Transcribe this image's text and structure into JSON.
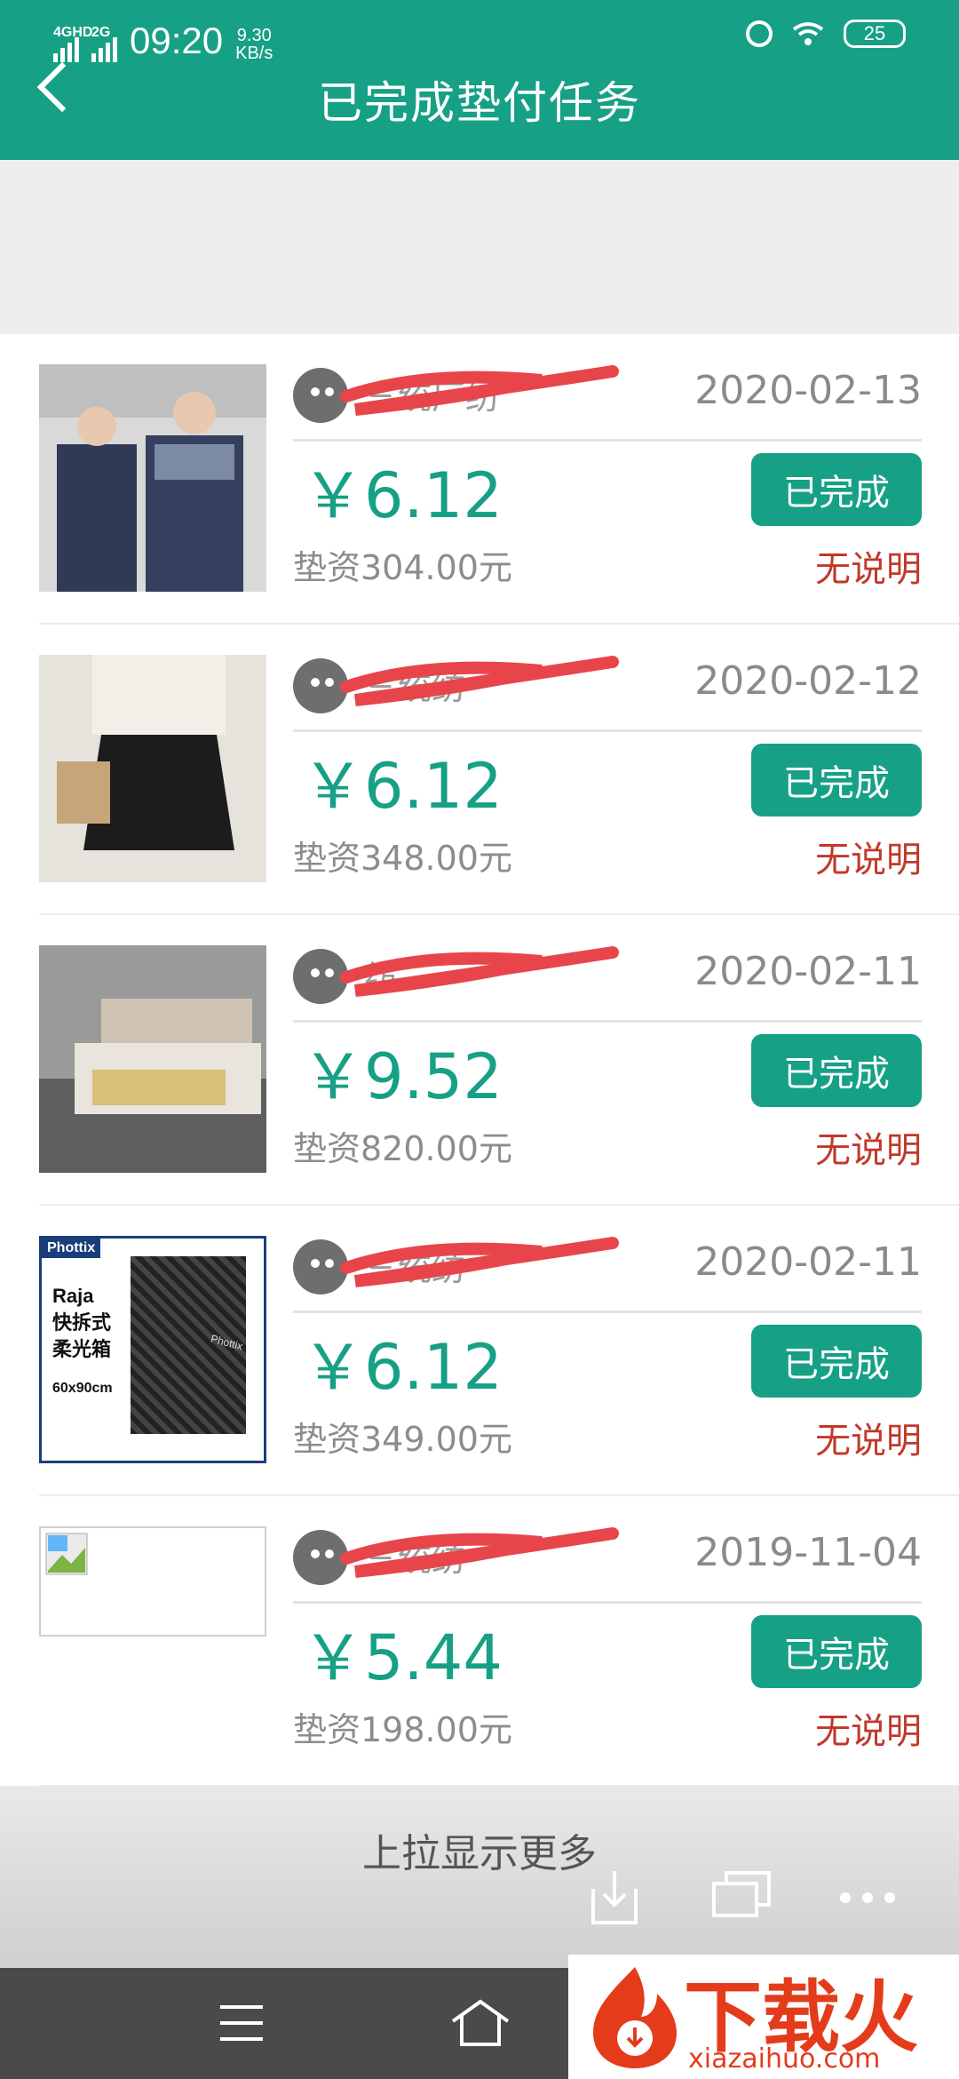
{
  "status_bar": {
    "network1": "4GHD",
    "network2": "2G",
    "time": "09:20",
    "speed_value": "9.30",
    "speed_unit": "KB/s",
    "battery": "25"
  },
  "header": {
    "title": "已完成垫付任务",
    "back_icon": "chevron-left-icon"
  },
  "tasks": [
    {
      "shop": "三统厂纺",
      "date": "2020-02-13",
      "amount": "￥6.12",
      "status": "已完成",
      "advance": "垫资304.00元",
      "note": "无说明",
      "thumb": "workwear"
    },
    {
      "shop": "三统纺",
      "date": "2020-02-12",
      "amount": "￥6.12",
      "status": "已完成",
      "advance": "垫资348.00元",
      "note": "无说明",
      "thumb": "skirt"
    },
    {
      "shop": "纺",
      "date": "2020-02-11",
      "amount": "￥9.52",
      "status": "已完成",
      "advance": "垫资820.00元",
      "note": "无说明",
      "thumb": "bed"
    },
    {
      "shop": "三统纺",
      "date": "2020-02-11",
      "amount": "￥6.12",
      "status": "已完成",
      "advance": "垫资349.00元",
      "note": "无说明",
      "thumb": "softbox",
      "thumb_text": {
        "brand": "Phottix",
        "line1": "Raja",
        "line2": "快拆式",
        "line3": "柔光箱",
        "size": "60x90cm"
      }
    },
    {
      "shop": "三统纺",
      "date": "2019-11-04",
      "amount": "￥5.44",
      "status": "已完成",
      "advance": "垫资198.00元",
      "note": "无说明",
      "thumb": "broken"
    }
  ],
  "footer": {
    "load_more": "上拉显示更多"
  },
  "watermark": {
    "text": "下载火",
    "url": "xiazaihuo.com"
  },
  "colors": {
    "accent": "#16a085",
    "note": "#c0392b"
  }
}
